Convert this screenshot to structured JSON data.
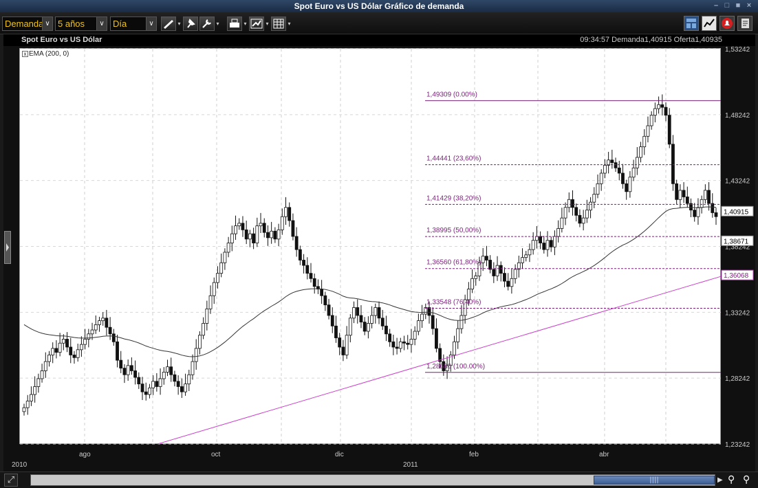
{
  "window": {
    "title": "Spot Euro vs US Dólar Gráfico de demanda",
    "controls": [
      "minimize-icon",
      "restore-icon",
      "close-icon"
    ]
  },
  "toolbar": {
    "price_type": "Demanda",
    "range": "5 años",
    "interval": "Día"
  },
  "chart_header": {
    "title": "Spot Euro vs US Dólar",
    "quote": "09:34:57  Demanda1,40915  Oferta1,40935"
  },
  "indicator": {
    "label": "EMA (200, 0)"
  },
  "colors": {
    "fib": "#7a1f7a",
    "trend": "#cc44cc",
    "ema": "#333333",
    "toolbar_text": "#f0c419",
    "titlebar": "#2f4766"
  },
  "chart_data": {
    "type": "candlestick",
    "ylim": [
      1.23242,
      1.53242
    ],
    "y_ticks": [
      "1,53242",
      "1,48242",
      "1,43242",
      "1,38242",
      "1,33242",
      "1,28242",
      "1,23242"
    ],
    "y_tick_values": [
      1.53242,
      1.48242,
      1.43242,
      1.38242,
      1.33242,
      1.28242,
      1.23242
    ],
    "x_tick_labels": [
      "ago",
      "oct",
      "dic",
      "feb",
      "abr"
    ],
    "x_year_labels": [
      "2010",
      "2011"
    ],
    "current_price": "1,40915",
    "ema_value": "1,38671",
    "trendline_value": "1,36068",
    "fibonacci": [
      {
        "price": 1.49309,
        "label": "1,49309  (0.00%)"
      },
      {
        "price": 1.44441,
        "label": "1,44441  (23,60%)"
      },
      {
        "price": 1.41429,
        "label": "1,41429  (38,20%)"
      },
      {
        "price": 1.38995,
        "label": "1,38995  (50,00%)"
      },
      {
        "price": 1.3656,
        "label": "1,36560  (61,80%)"
      },
      {
        "price": 1.33548,
        "label": "1,33548  (76,40%)"
      },
      {
        "price": 1.2868,
        "label": "1,28680  (100.00%)"
      }
    ],
    "closes": [
      1.26,
      1.265,
      1.27,
      1.276,
      1.282,
      1.288,
      1.295,
      1.3,
      1.305,
      1.302,
      1.309,
      1.312,
      1.306,
      1.3,
      1.298,
      1.304,
      1.308,
      1.312,
      1.316,
      1.319,
      1.323,
      1.326,
      1.328,
      1.321,
      1.316,
      1.31,
      1.296,
      1.29,
      1.285,
      1.292,
      1.288,
      1.283,
      1.278,
      1.272,
      1.27,
      1.275,
      1.28,
      1.276,
      1.282,
      1.287,
      1.291,
      1.285,
      1.28,
      1.276,
      1.272,
      1.278,
      1.285,
      1.295,
      1.305,
      1.315,
      1.324,
      1.335,
      1.345,
      1.355,
      1.362,
      1.37,
      1.378,
      1.385,
      1.392,
      1.398,
      1.4,
      1.395,
      1.388,
      1.392,
      1.385,
      1.398,
      1.4,
      1.393,
      1.389,
      1.394,
      1.388,
      1.395,
      1.405,
      1.412,
      1.402,
      1.39,
      1.38,
      1.372,
      1.368,
      1.362,
      1.358,
      1.352,
      1.35,
      1.345,
      1.338,
      1.33,
      1.322,
      1.313,
      1.306,
      1.3,
      1.315,
      1.328,
      1.336,
      1.33,
      1.325,
      1.318,
      1.324,
      1.33,
      1.336,
      1.328,
      1.322,
      1.316,
      1.31,
      1.306,
      1.305,
      1.31,
      1.309,
      1.308,
      1.312,
      1.318,
      1.326,
      1.331,
      1.336,
      1.33,
      1.32,
      1.305,
      1.295,
      1.288,
      1.292,
      1.3,
      1.31,
      1.32,
      1.33,
      1.342,
      1.35,
      1.358,
      1.36,
      1.37,
      1.375,
      1.372,
      1.365,
      1.36,
      1.368,
      1.362,
      1.356,
      1.352,
      1.358,
      1.365,
      1.37,
      1.374,
      1.376,
      1.38,
      1.387,
      1.39,
      1.385,
      1.38,
      1.387,
      1.382,
      1.39,
      1.396,
      1.404,
      1.412,
      1.418,
      1.412,
      1.406,
      1.4,
      1.404,
      1.41,
      1.416,
      1.422,
      1.43,
      1.438,
      1.444,
      1.448,
      1.446,
      1.442,
      1.438,
      1.43,
      1.424,
      1.435,
      1.442,
      1.45,
      1.458,
      1.466,
      1.474,
      1.482,
      1.487,
      1.49,
      1.488,
      1.482,
      1.46,
      1.43,
      1.418,
      1.425,
      1.42,
      1.415,
      1.41,
      1.405,
      1.412,
      1.418,
      1.425,
      1.415,
      1.408,
      1.405
    ]
  },
  "scrollbar": {
    "grip": "||||"
  }
}
